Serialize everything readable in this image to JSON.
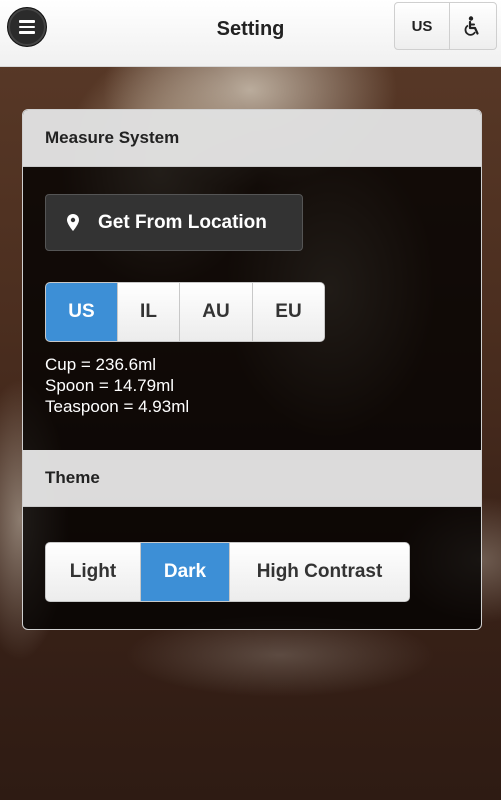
{
  "header": {
    "title": "Setting",
    "menu_icon": "hamburger-menu-icon",
    "unit_badge": "US",
    "accessibility_icon": "accessibility-icon"
  },
  "measure_system": {
    "heading": "Measure System",
    "location_button": {
      "label": "Get From Location",
      "icon": "location-pin-icon"
    },
    "units": [
      {
        "label": "US",
        "active": true
      },
      {
        "label": "IL",
        "active": false
      },
      {
        "label": "AU",
        "active": false
      },
      {
        "label": "EU",
        "active": false
      }
    ],
    "conversions": [
      "Cup = 236.6ml",
      "Spoon = 14.79ml",
      "Teaspoon = 4.93ml"
    ]
  },
  "theme": {
    "heading": "Theme",
    "options": [
      {
        "label": "Light",
        "active": false
      },
      {
        "label": "Dark",
        "active": true
      },
      {
        "label": "High Contrast",
        "active": false
      }
    ]
  },
  "colors": {
    "accent": "#3d8fd6",
    "header_bg": "#f5f5f5",
    "panel_bg": "#000000"
  }
}
